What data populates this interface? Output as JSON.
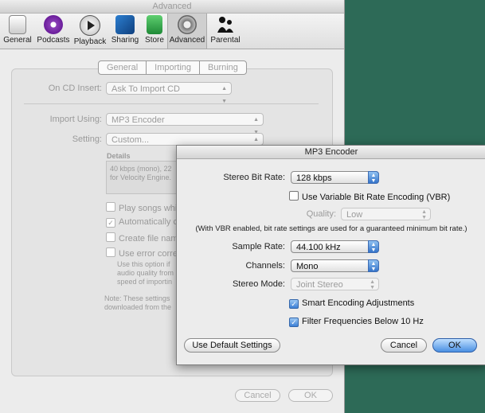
{
  "window": {
    "title": "Advanced",
    "toolbar": [
      {
        "label": "General",
        "icon": "general-icon"
      },
      {
        "label": "Podcasts",
        "icon": "podcasts-icon"
      },
      {
        "label": "Playback",
        "icon": "playback-icon"
      },
      {
        "label": "Sharing",
        "icon": "sharing-icon"
      },
      {
        "label": "Store",
        "icon": "store-icon"
      },
      {
        "label": "Advanced",
        "icon": "gear-icon"
      },
      {
        "label": "Parental",
        "icon": "parental-icon"
      }
    ],
    "tabs": [
      "General",
      "Importing",
      "Burning"
    ],
    "on_cd_insert_label": "On CD Insert:",
    "on_cd_insert_value": "Ask To Import CD",
    "import_using_label": "Import Using:",
    "import_using_value": "MP3 Encoder",
    "setting_label": "Setting:",
    "setting_value": "Custom...",
    "details_label": "Details",
    "details_text_1": "40 kbps (mono), 22",
    "details_text_2": "for Velocity Engine.",
    "checkboxes": [
      {
        "label": "Play songs whi",
        "checked": false
      },
      {
        "label": "Automatically c",
        "checked": true
      },
      {
        "label": "Create file nam",
        "checked": false
      },
      {
        "label": "Use error corre",
        "checked": false
      }
    ],
    "error_desc_1": "Use this option if",
    "error_desc_2": "audio quality from",
    "error_desc_3": "speed of importin",
    "note_1": "Note: These settings",
    "note_2": "downloaded from the",
    "cancel": "Cancel",
    "ok": "OK"
  },
  "sheet": {
    "title": "MP3 Encoder",
    "stereo_bit_rate_label": "Stereo Bit Rate:",
    "stereo_bit_rate_value": "128 kbps",
    "vbr_label": "Use Variable Bit Rate Encoding (VBR)",
    "quality_label": "Quality:",
    "quality_value": "Low",
    "vbr_note": "(With VBR enabled, bit rate settings are used for a guaranteed minimum bit rate.)",
    "sample_rate_label": "Sample Rate:",
    "sample_rate_value": "44.100 kHz",
    "channels_label": "Channels:",
    "channels_value": "Mono",
    "stereo_mode_label": "Stereo Mode:",
    "stereo_mode_value": "Joint Stereo",
    "smart_encoding_label": "Smart Encoding Adjustments",
    "filter_label": "Filter Frequencies Below 10 Hz",
    "default_button": "Use Default Settings",
    "cancel": "Cancel",
    "ok": "OK"
  },
  "colors": {
    "desktop": "#2d6a57",
    "accent": "#3c7fd5"
  }
}
